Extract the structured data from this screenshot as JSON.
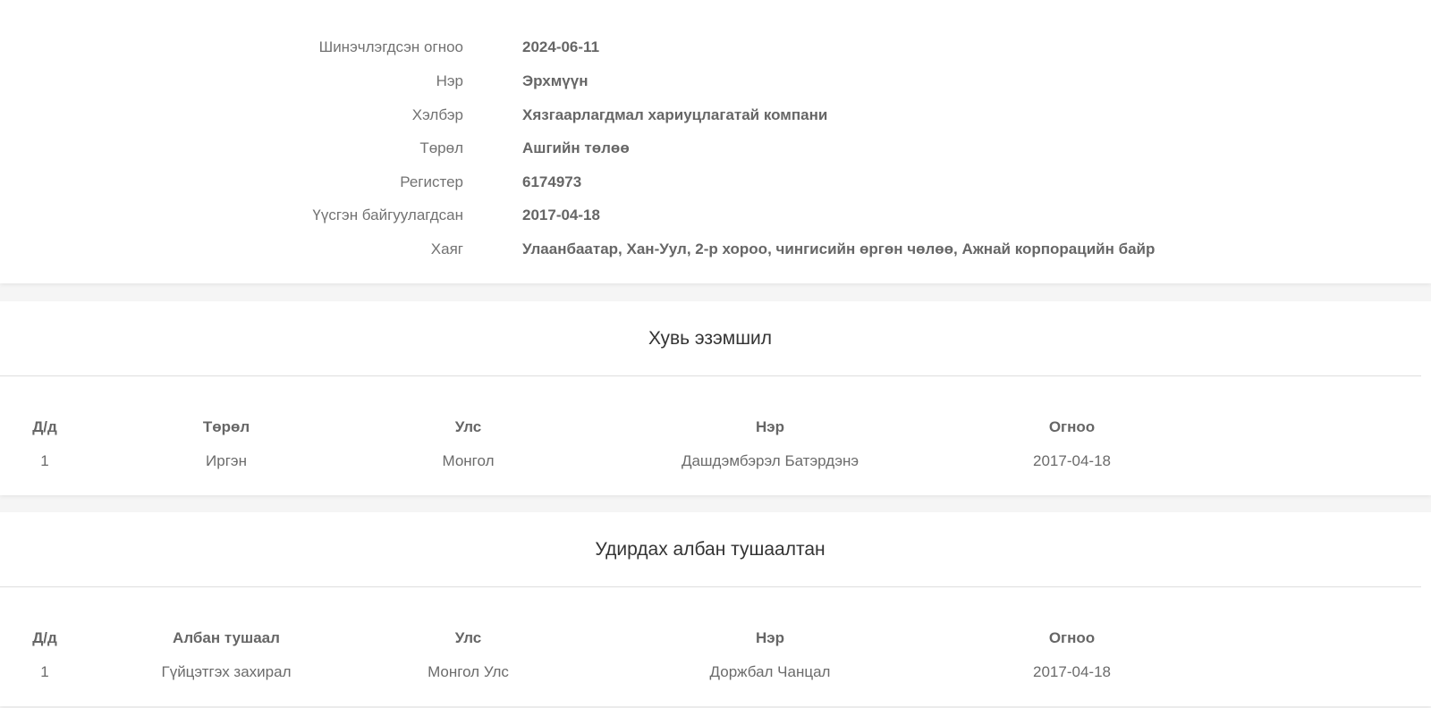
{
  "company": {
    "fields": [
      {
        "label": "Шинэчлэгдсэн огноо",
        "value": "2024-06-11"
      },
      {
        "label": "Нэр",
        "value": "Эрхмүүн"
      },
      {
        "label": "Хэлбэр",
        "value": "Хязгаарлагдмал хариуцлагатай компани"
      },
      {
        "label": "Төрөл",
        "value": "Ашгийн төлөө"
      },
      {
        "label": "Регистер",
        "value": "6174973"
      },
      {
        "label": "Үүсгэн байгуулагдсан",
        "value": "2017-04-18"
      },
      {
        "label": "Хаяг",
        "value": "Улаанбаатар, Хан-Уул, 2-р хороо, чингисийн өргөн чөлөө, Ажнай корпорацийн байр"
      }
    ]
  },
  "ownership": {
    "title": "Хувь эзэмшил",
    "columns": [
      "Д/д",
      "Төрөл",
      "Улс",
      "Нэр",
      "Огноо"
    ],
    "rows": [
      [
        "1",
        "Иргэн",
        "Монгол",
        "Дашдэмбэрэл Батэрдэнэ",
        "2017-04-18"
      ]
    ]
  },
  "officials": {
    "title": "Удирдах албан тушаалтан",
    "columns": [
      "Д/д",
      "Албан тушаал",
      "Улс",
      "Нэр",
      "Огноо"
    ],
    "rows": [
      [
        "1",
        "Гүйцэтгэх захирал",
        "Монгол Улс",
        "Доржбал Чанцал",
        "2017-04-18"
      ]
    ]
  }
}
